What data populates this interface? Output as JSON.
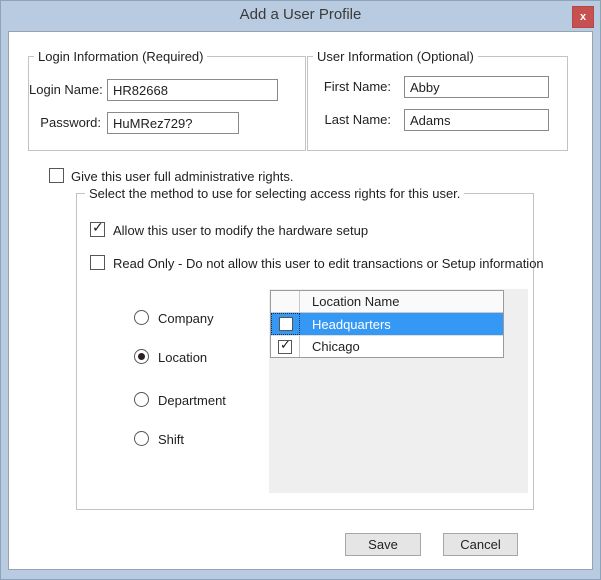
{
  "window": {
    "title": "Add a User Profile",
    "close_glyph": "x"
  },
  "login_group": {
    "title": "Login Information (Required)",
    "fields": [
      {
        "label": "Login Name:",
        "value": "HR82668"
      },
      {
        "label": "Password:",
        "value": "HuMRez729?"
      }
    ]
  },
  "user_group": {
    "title": "User Information (Optional)",
    "fields": [
      {
        "label": "First Name:",
        "value": "Abby"
      },
      {
        "label": "Last Name:",
        "value": "Adams"
      }
    ]
  },
  "admin_checkbox": {
    "label": "Give this user full administrative rights.",
    "checked": false
  },
  "method_group": {
    "title": "Select the method to use for selecting access rights for this user.",
    "checkboxes": [
      {
        "label": "Allow this user to modify the hardware setup",
        "checked": true
      },
      {
        "label": "Read Only - Do not allow this user to edit transactions or Setup information",
        "checked": false
      }
    ],
    "radios": [
      {
        "label": "Company",
        "selected": false
      },
      {
        "label": "Location",
        "selected": true
      },
      {
        "label": "Department",
        "selected": false
      },
      {
        "label": "Shift",
        "selected": false
      }
    ],
    "grid": {
      "header": "Location Name",
      "rows": [
        {
          "name": "Headquarters",
          "checked": false,
          "selected": true
        },
        {
          "name": "Chicago",
          "checked": true,
          "selected": false
        }
      ]
    }
  },
  "buttons": {
    "save": "Save",
    "cancel": "Cancel"
  },
  "colors": {
    "frame_blue": "#b8cbe0",
    "close_red": "#c75050",
    "selection_blue": "#3698f5",
    "panel_gray": "#efefef"
  }
}
